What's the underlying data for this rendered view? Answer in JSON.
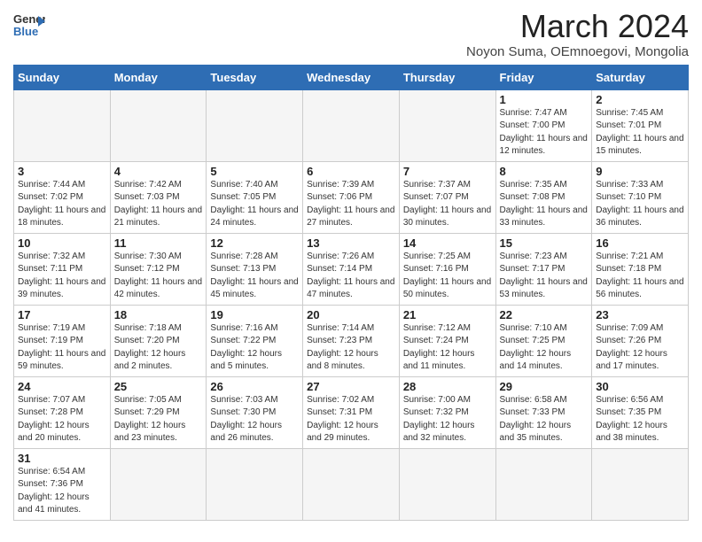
{
  "logo": {
    "line1": "General",
    "line2": "Blue"
  },
  "title": "March 2024",
  "subtitle": "Noyon Suma, OEmnoegovi, Mongolia",
  "days_of_week": [
    "Sunday",
    "Monday",
    "Tuesday",
    "Wednesday",
    "Thursday",
    "Friday",
    "Saturday"
  ],
  "weeks": [
    [
      {
        "num": "",
        "info": ""
      },
      {
        "num": "",
        "info": ""
      },
      {
        "num": "",
        "info": ""
      },
      {
        "num": "",
        "info": ""
      },
      {
        "num": "",
        "info": ""
      },
      {
        "num": "1",
        "info": "Sunrise: 7:47 AM\nSunset: 7:00 PM\nDaylight: 11 hours and 12 minutes."
      },
      {
        "num": "2",
        "info": "Sunrise: 7:45 AM\nSunset: 7:01 PM\nDaylight: 11 hours and 15 minutes."
      }
    ],
    [
      {
        "num": "3",
        "info": "Sunrise: 7:44 AM\nSunset: 7:02 PM\nDaylight: 11 hours and 18 minutes."
      },
      {
        "num": "4",
        "info": "Sunrise: 7:42 AM\nSunset: 7:03 PM\nDaylight: 11 hours and 21 minutes."
      },
      {
        "num": "5",
        "info": "Sunrise: 7:40 AM\nSunset: 7:05 PM\nDaylight: 11 hours and 24 minutes."
      },
      {
        "num": "6",
        "info": "Sunrise: 7:39 AM\nSunset: 7:06 PM\nDaylight: 11 hours and 27 minutes."
      },
      {
        "num": "7",
        "info": "Sunrise: 7:37 AM\nSunset: 7:07 PM\nDaylight: 11 hours and 30 minutes."
      },
      {
        "num": "8",
        "info": "Sunrise: 7:35 AM\nSunset: 7:08 PM\nDaylight: 11 hours and 33 minutes."
      },
      {
        "num": "9",
        "info": "Sunrise: 7:33 AM\nSunset: 7:10 PM\nDaylight: 11 hours and 36 minutes."
      }
    ],
    [
      {
        "num": "10",
        "info": "Sunrise: 7:32 AM\nSunset: 7:11 PM\nDaylight: 11 hours and 39 minutes."
      },
      {
        "num": "11",
        "info": "Sunrise: 7:30 AM\nSunset: 7:12 PM\nDaylight: 11 hours and 42 minutes."
      },
      {
        "num": "12",
        "info": "Sunrise: 7:28 AM\nSunset: 7:13 PM\nDaylight: 11 hours and 45 minutes."
      },
      {
        "num": "13",
        "info": "Sunrise: 7:26 AM\nSunset: 7:14 PM\nDaylight: 11 hours and 47 minutes."
      },
      {
        "num": "14",
        "info": "Sunrise: 7:25 AM\nSunset: 7:16 PM\nDaylight: 11 hours and 50 minutes."
      },
      {
        "num": "15",
        "info": "Sunrise: 7:23 AM\nSunset: 7:17 PM\nDaylight: 11 hours and 53 minutes."
      },
      {
        "num": "16",
        "info": "Sunrise: 7:21 AM\nSunset: 7:18 PM\nDaylight: 11 hours and 56 minutes."
      }
    ],
    [
      {
        "num": "17",
        "info": "Sunrise: 7:19 AM\nSunset: 7:19 PM\nDaylight: 11 hours and 59 minutes."
      },
      {
        "num": "18",
        "info": "Sunrise: 7:18 AM\nSunset: 7:20 PM\nDaylight: 12 hours and 2 minutes."
      },
      {
        "num": "19",
        "info": "Sunrise: 7:16 AM\nSunset: 7:22 PM\nDaylight: 12 hours and 5 minutes."
      },
      {
        "num": "20",
        "info": "Sunrise: 7:14 AM\nSunset: 7:23 PM\nDaylight: 12 hours and 8 minutes."
      },
      {
        "num": "21",
        "info": "Sunrise: 7:12 AM\nSunset: 7:24 PM\nDaylight: 12 hours and 11 minutes."
      },
      {
        "num": "22",
        "info": "Sunrise: 7:10 AM\nSunset: 7:25 PM\nDaylight: 12 hours and 14 minutes."
      },
      {
        "num": "23",
        "info": "Sunrise: 7:09 AM\nSunset: 7:26 PM\nDaylight: 12 hours and 17 minutes."
      }
    ],
    [
      {
        "num": "24",
        "info": "Sunrise: 7:07 AM\nSunset: 7:28 PM\nDaylight: 12 hours and 20 minutes."
      },
      {
        "num": "25",
        "info": "Sunrise: 7:05 AM\nSunset: 7:29 PM\nDaylight: 12 hours and 23 minutes."
      },
      {
        "num": "26",
        "info": "Sunrise: 7:03 AM\nSunset: 7:30 PM\nDaylight: 12 hours and 26 minutes."
      },
      {
        "num": "27",
        "info": "Sunrise: 7:02 AM\nSunset: 7:31 PM\nDaylight: 12 hours and 29 minutes."
      },
      {
        "num": "28",
        "info": "Sunrise: 7:00 AM\nSunset: 7:32 PM\nDaylight: 12 hours and 32 minutes."
      },
      {
        "num": "29",
        "info": "Sunrise: 6:58 AM\nSunset: 7:33 PM\nDaylight: 12 hours and 35 minutes."
      },
      {
        "num": "30",
        "info": "Sunrise: 6:56 AM\nSunset: 7:35 PM\nDaylight: 12 hours and 38 minutes."
      }
    ],
    [
      {
        "num": "31",
        "info": "Sunrise: 6:54 AM\nSunset: 7:36 PM\nDaylight: 12 hours and 41 minutes."
      },
      {
        "num": "",
        "info": ""
      },
      {
        "num": "",
        "info": ""
      },
      {
        "num": "",
        "info": ""
      },
      {
        "num": "",
        "info": ""
      },
      {
        "num": "",
        "info": ""
      },
      {
        "num": "",
        "info": ""
      }
    ]
  ]
}
